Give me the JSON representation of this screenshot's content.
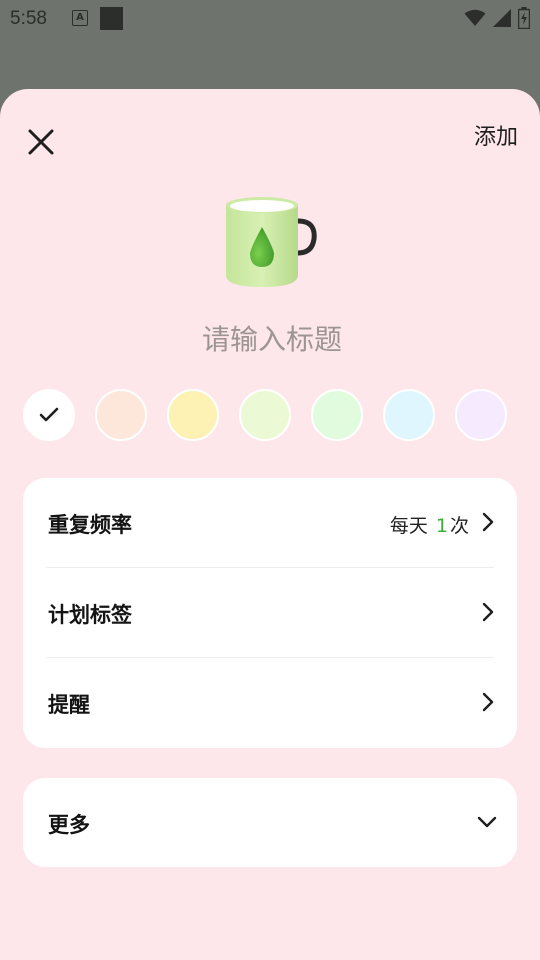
{
  "status_bar": {
    "time": "5:58",
    "icons": [
      "a-notification-icon",
      "square-notification-icon",
      "wifi-icon",
      "signal-icon",
      "battery-charging-icon"
    ]
  },
  "header": {
    "close_icon": "close-icon",
    "add_label": "添加"
  },
  "habit_icon": "mug-water-drop-icon",
  "title_field": {
    "value": "",
    "placeholder": "请输入标题"
  },
  "color_swatches": [
    {
      "color": "#ffffff",
      "selected": true
    },
    {
      "color": "#fde6da",
      "selected": false
    },
    {
      "color": "#fdf1b4",
      "selected": false
    },
    {
      "color": "#ebfad4",
      "selected": false
    },
    {
      "color": "#e1fbde",
      "selected": false
    },
    {
      "color": "#dff6fe",
      "selected": false
    },
    {
      "color": "#f6eafe",
      "selected": false
    }
  ],
  "settings": {
    "repeat": {
      "label": "重复频率",
      "value_prefix": "每天",
      "value_count": "1",
      "value_suffix": "次"
    },
    "tags": {
      "label": "计划标签"
    },
    "reminder": {
      "label": "提醒"
    }
  },
  "more": {
    "label": "更多"
  },
  "colors": {
    "sheet_background": "#fee7ea",
    "accent_green": "#3cae3a",
    "scrim": "#6e746d"
  }
}
